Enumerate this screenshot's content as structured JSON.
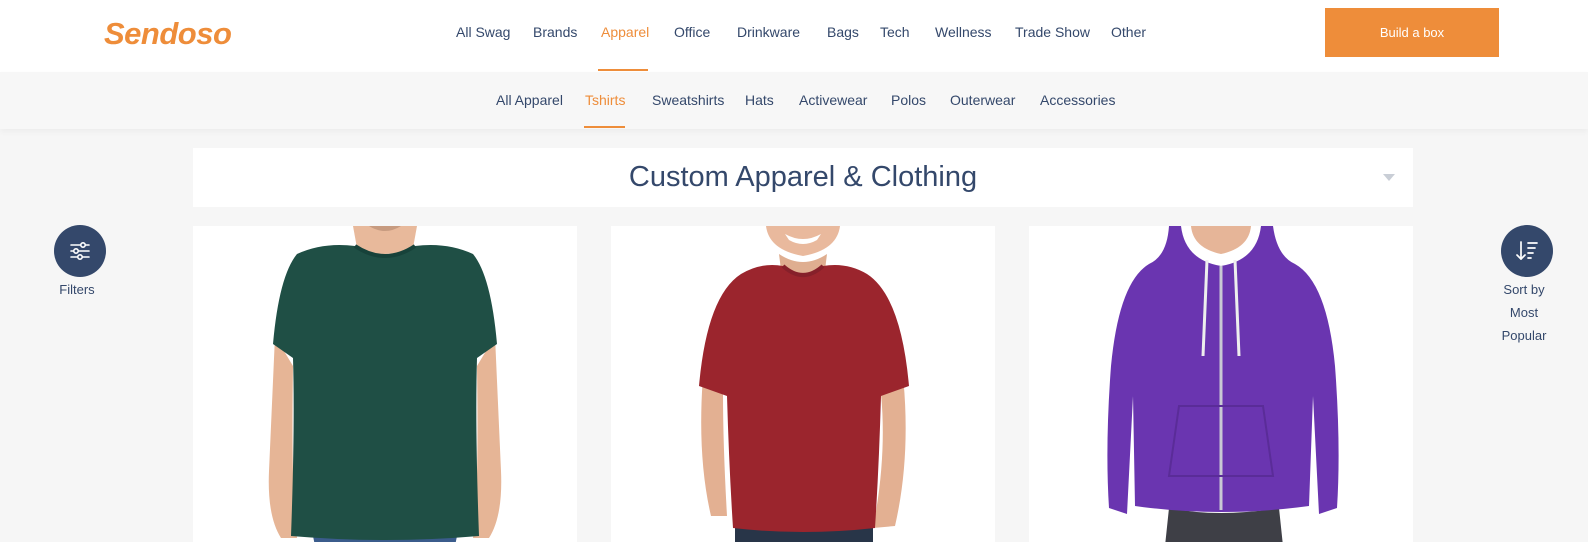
{
  "brand": {
    "logo_text": "Sendoso",
    "logo_color": "#ee8d3a"
  },
  "main_nav": [
    {
      "label": "All Swag",
      "active": false
    },
    {
      "label": "Brands",
      "active": false
    },
    {
      "label": "Apparel",
      "active": true
    },
    {
      "label": "Office",
      "active": false
    },
    {
      "label": "Drinkware",
      "active": false
    },
    {
      "label": "Bags",
      "active": false
    },
    {
      "label": "Tech",
      "active": false
    },
    {
      "label": "Wellness",
      "active": false
    },
    {
      "label": "Trade Show",
      "active": false
    },
    {
      "label": "Other",
      "active": false
    }
  ],
  "cta": {
    "label": "Build a box"
  },
  "sub_nav": [
    {
      "label": "All Apparel",
      "active": false
    },
    {
      "label": "Tshirts",
      "active": true
    },
    {
      "label": "Sweatshirts",
      "active": false
    },
    {
      "label": "Hats",
      "active": false
    },
    {
      "label": "Activewear",
      "active": false
    },
    {
      "label": "Polos",
      "active": false
    },
    {
      "label": "Outerwear",
      "active": false
    },
    {
      "label": "Accessories",
      "active": false
    }
  ],
  "page": {
    "title": "Custom Apparel & Clothing"
  },
  "filters": {
    "label": "Filters",
    "icon": "sliders-icon"
  },
  "sort": {
    "label_line1": "Sort by",
    "label_line2": "Most",
    "label_line3": "Popular",
    "icon": "sort-descending-icon"
  },
  "products": [
    {
      "image": "green-tshirt-model",
      "shirt_color": "#1f4f45"
    },
    {
      "image": "red-tshirt-model",
      "shirt_color": "#9b252d"
    },
    {
      "image": "purple-zip-hoodie-model",
      "shirt_color": "#6a35b0"
    }
  ],
  "colors": {
    "accent": "#ee8d3a",
    "navy": "#34486b",
    "background": "#f6f6f6"
  }
}
